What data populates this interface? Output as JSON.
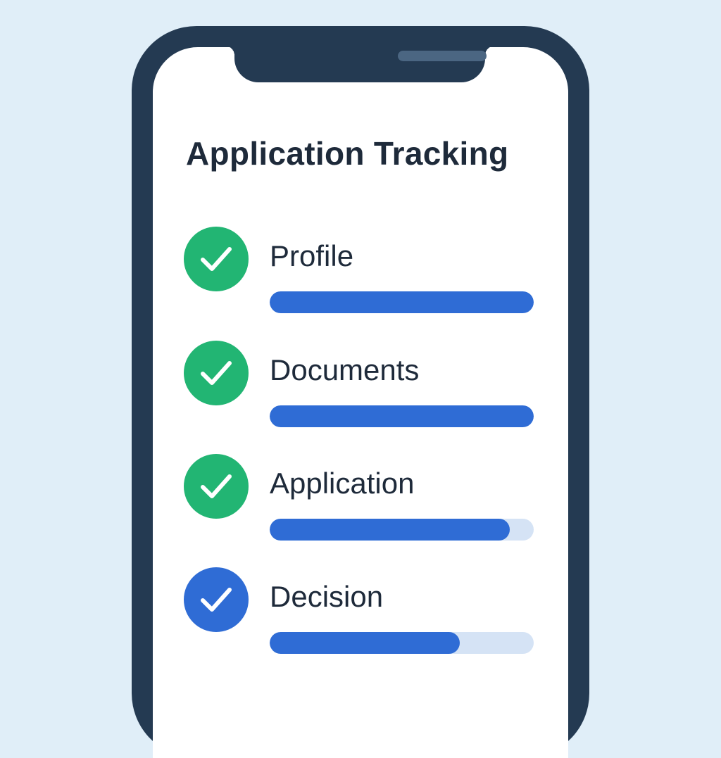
{
  "title": "Application Tracking",
  "colors": {
    "background": "#E0EEF8",
    "phone_frame": "#243A52",
    "complete": "#22B573",
    "current": "#2F6CD5",
    "progress_fill": "#2F6CD5",
    "progress_track": "#D5E3F5",
    "text": "#1E2A3A"
  },
  "steps": [
    {
      "label": "Profile",
      "progress": 1.0,
      "icon": "check-circle-icon",
      "status": "complete"
    },
    {
      "label": "Documents",
      "progress": 1.0,
      "icon": "check-circle-icon",
      "status": "complete"
    },
    {
      "label": "Application",
      "progress": 0.91,
      "icon": "check-circle-icon",
      "status": "complete"
    },
    {
      "label": "Decision",
      "progress": 0.72,
      "icon": "check-circle-icon",
      "status": "current"
    }
  ]
}
